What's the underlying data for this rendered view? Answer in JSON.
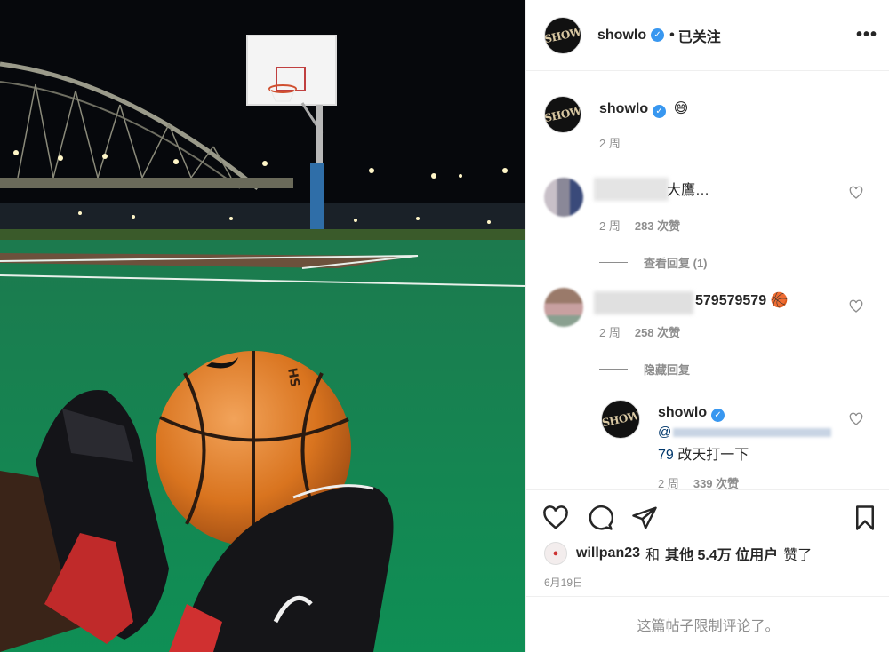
{
  "photo": {
    "alt": "",
    "ball_brand": "HS"
  },
  "header": {
    "avatar_text": "SHOW",
    "username": "showlo",
    "verified_icon": "verified-badge-icon",
    "separator": "•",
    "follow_status": "已关注",
    "more_label": "•••"
  },
  "caption": {
    "username": "showlo",
    "emoji": "😅",
    "time": "2 周"
  },
  "comments": [
    {
      "text": "大鷹…",
      "time": "2 周",
      "likes": "283 次赞",
      "replies_label": "查看回复 (1)"
    },
    {
      "text": "579579579",
      "emoji": "🏀",
      "time": "2 周",
      "likes": "258 次赞",
      "replies_label": "隐藏回复"
    }
  ],
  "reply": {
    "avatar_text": "SHOW",
    "username": "showlo",
    "mention": "@",
    "mention_tail": "79",
    "text": "改天打一下",
    "time": "2 周",
    "likes": "339 次赞"
  },
  "likes_line": {
    "user": "willpan23",
    "and": "和",
    "others": "其他 5.4万 位用户",
    "suffix": "赞了"
  },
  "post_date": "6月19日",
  "comments_restricted": "这篇帖子限制评论了。",
  "colors": {
    "court_green": "#138a52",
    "ball_orange": "#e07b2a",
    "verified_blue": "#3897f0",
    "muted_text": "#8e8e8e"
  }
}
